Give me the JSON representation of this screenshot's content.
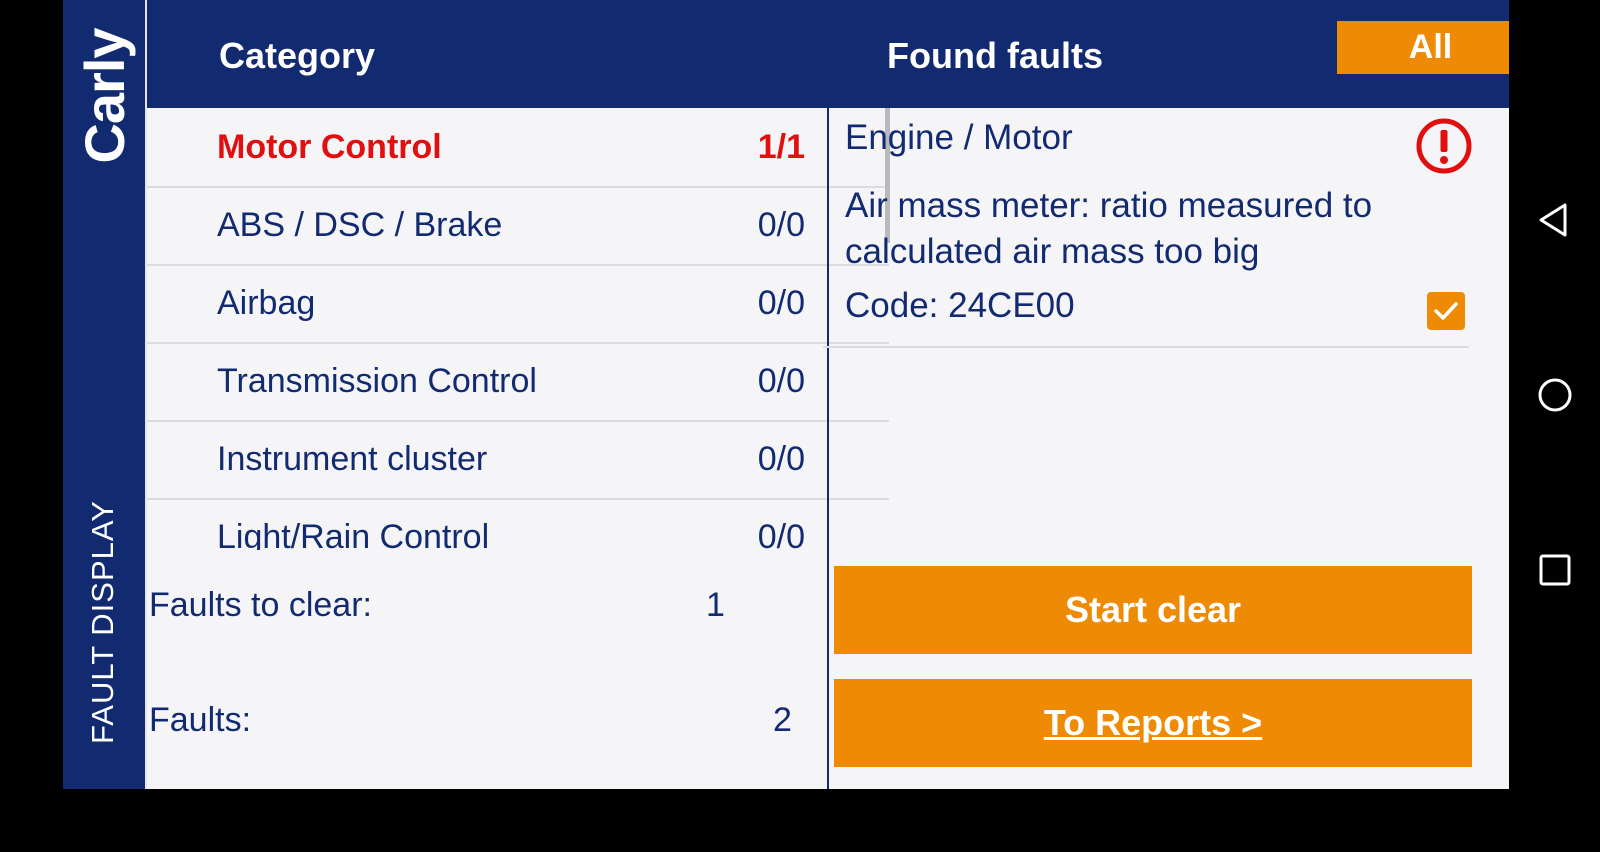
{
  "brand": {
    "logo_text": "Carly",
    "section_label": "FAULT DISPLAY"
  },
  "header": {
    "category_title": "Category",
    "found_faults_title": "Found faults",
    "filter_button": "All"
  },
  "categories": [
    {
      "name": "Motor Control",
      "count": "1/1",
      "active": true
    },
    {
      "name": "ABS / DSC / Brake",
      "count": "0/0"
    },
    {
      "name": "Airbag",
      "count": "0/0"
    },
    {
      "name": "Transmission Control",
      "count": "0/0"
    },
    {
      "name": "Instrument cluster",
      "count": "0/0"
    },
    {
      "name": "Light/Rain Control",
      "count": "0/0"
    }
  ],
  "summary": {
    "faults_to_clear_label": "Faults to clear:",
    "faults_to_clear_value": "1",
    "faults_label": "Faults:",
    "faults_value": "2"
  },
  "fault": {
    "group": "Engine / Motor",
    "description": "Air mass meter: ratio measured to calculated air mass too big",
    "code": "Code: 24CE00",
    "selected": true,
    "status_icon": "alert-icon"
  },
  "actions": {
    "start_clear": "Start clear",
    "to_reports": "To Reports >"
  },
  "colors": {
    "primary": "#122a70",
    "accent": "#ef8a05",
    "alert": "#e01010",
    "background": "#f5f5f7"
  },
  "system_nav": [
    "back-icon",
    "home-icon",
    "recents-icon"
  ]
}
